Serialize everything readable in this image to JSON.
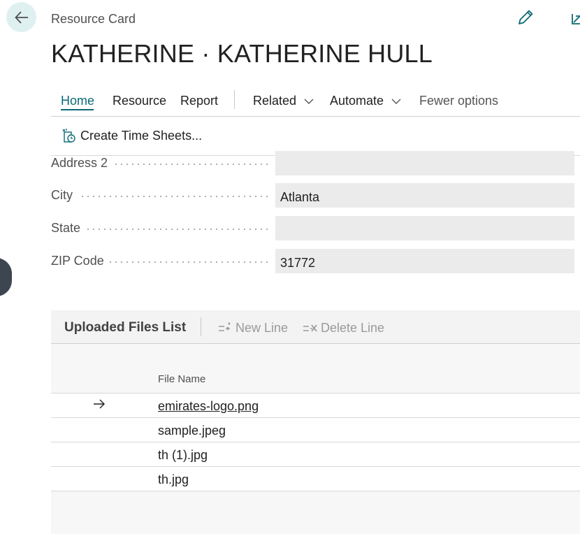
{
  "header": {
    "caption": "Resource Card",
    "title": "KATHERINE · KATHERINE HULL"
  },
  "icons": {
    "back": "arrow-left-icon",
    "edit": "pencil-icon",
    "share": "open-in-new-icon",
    "timesheet": "timesheet-icon",
    "new_line": "new-line-icon",
    "delete_line": "delete-line-icon",
    "current_row": "arrow-right-icon"
  },
  "colors": {
    "accent": "#0b6a75",
    "back_button_bg": "#dff0f1",
    "field_bg": "#ebebeb",
    "disabled_text": "#9a9a9a"
  },
  "actions": {
    "tabs": [
      "Home",
      "Resource",
      "Report"
    ],
    "related": "Related",
    "automate": "Automate",
    "fewer_options": "Fewer options",
    "create_time_sheets": "Create Time Sheets..."
  },
  "fields": [
    {
      "label": "Address 2",
      "value": ""
    },
    {
      "label": "City",
      "value": "Atlanta"
    },
    {
      "label": "State",
      "value": ""
    },
    {
      "label": "ZIP Code",
      "value": "31772"
    }
  ],
  "files": {
    "title": "Uploaded Files List",
    "new_line": "New Line",
    "delete_line": "Delete Line",
    "column_header": "File Name",
    "rows": [
      "emirates-logo.png",
      "sample.jpeg",
      "th (1).jpg",
      "th.jpg"
    ]
  }
}
